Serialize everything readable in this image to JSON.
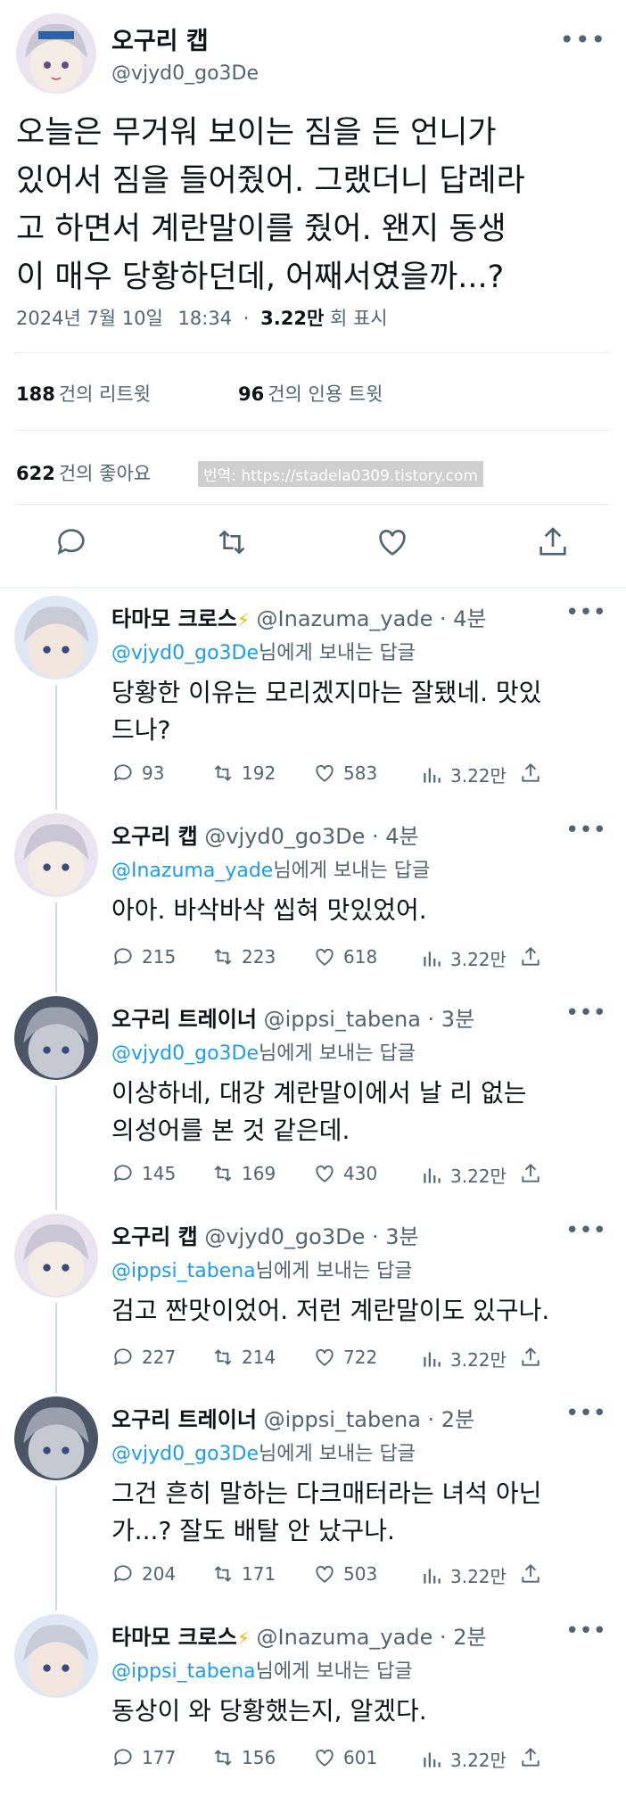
{
  "main_tweet": {
    "name": "오구리 캡",
    "handle": "@vjyd0_go3De",
    "more_icon": "more-dots-icon",
    "text": "오늘은 무거워 보이는 짐을 든 언니가\n있어서 짐을 들어줬어. 그랬더니 답례라\n고 하면서 계란말이를 줬어. 왠지 동생\n이 매우 당황하던데, 어째서였을까...?",
    "date": "2024년 7월 10일",
    "time": "18:34",
    "views": "3.22만",
    "views_label": "회 표시",
    "retweets": "188",
    "retweets_label": "건의 리트윗",
    "quotes": "96",
    "quotes_label": "건의 인용 트윗",
    "likes": "622",
    "likes_label": "건의 좋아요",
    "watermark": "번역: https://stadela0309.tistory.com",
    "actions": [
      "reply-icon",
      "retweet-icon",
      "like-icon",
      "share-icon"
    ]
  },
  "replies": [
    {
      "name": "타마모 크로스",
      "badge": "⚡",
      "handle": "@Inazuma_yade",
      "time": "· 4분",
      "to_handle": "@vjyd0_go3De",
      "to_suffix": "님에게 보내는 답글",
      "text": "당황한 이유는 모리겠지마는 잘됐네. 맛있\n드나?",
      "replies": "93",
      "retweets": "192",
      "likes": "583",
      "views": "3.22만"
    },
    {
      "name": "오구리 캡",
      "badge": "",
      "handle": "@vjyd0_go3De",
      "time": "· 4분",
      "to_handle": "@Inazuma_yade",
      "to_suffix": "님에게 보내는 답글",
      "text": "아아. 바삭바삭 씹혀 맛있었어.",
      "replies": "215",
      "retweets": "223",
      "likes": "618",
      "views": "3.22만"
    },
    {
      "name": "오구리 트레이너",
      "badge": "",
      "handle": "@ippsi_tabena",
      "time": "· 3분",
      "to_handle": "@vjyd0_go3De",
      "to_suffix": "님에게 보내는 답글",
      "text": "이상하네, 대강 계란말이에서 날 리 없는\n의성어를 본 것 같은데.",
      "replies": "145",
      "retweets": "169",
      "likes": "430",
      "views": "3.22만"
    },
    {
      "name": "오구리 캡",
      "badge": "",
      "handle": "@vjyd0_go3De",
      "time": "· 3분",
      "to_handle": "@ippsi_tabena",
      "to_suffix": "님에게 보내는 답글",
      "text": "검고 짠맛이었어. 저런 계란말이도 있구나.",
      "replies": "227",
      "retweets": "214",
      "likes": "722",
      "views": "3.22만"
    },
    {
      "name": "오구리 트레이너",
      "badge": "",
      "handle": "@ippsi_tabena",
      "time": "· 2분",
      "to_handle": "@vjyd0_go3De",
      "to_suffix": "님에게 보내는 답글",
      "text": "그건 흔히 말하는 다크매터라는 녀석 아닌\n가...? 잘도 배탈 안 났구나.",
      "replies": "204",
      "retweets": "171",
      "likes": "503",
      "views": "3.22만"
    },
    {
      "name": "타마모 크로스",
      "badge": "⚡",
      "handle": "@Inazuma_yade",
      "time": "· 2분",
      "to_handle": "@ippsi_tabena",
      "to_suffix": "님에게 보내는 답글",
      "text": "동상이 와 당황했는지, 알겠다.",
      "replies": "177",
      "retweets": "156",
      "likes": "601",
      "views": "3.22만"
    }
  ],
  "colors": {
    "link": "#1d9bf0",
    "muted": "#536471",
    "text": "#0f1419"
  }
}
